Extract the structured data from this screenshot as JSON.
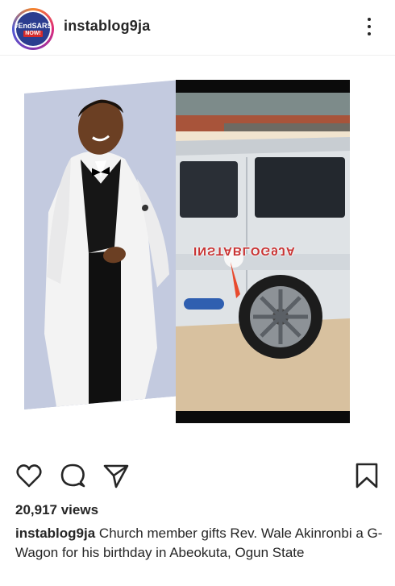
{
  "header": {
    "username": "instablog9ja",
    "avatar_text_line1": "#EndSARS",
    "avatar_text_line2": "NOW!"
  },
  "post": {
    "watermark": "INSTABLOG9JA",
    "views": "20,917 views",
    "caption_user": "instablog9ja",
    "caption_text": "Church member gifts Rev. Wale Akinronbi a G-Wagon for his birthday in Abeokuta, Ogun State"
  },
  "icons": [
    "more-options-icon",
    "heart-icon",
    "comment-icon",
    "share-icon",
    "bookmark-icon"
  ],
  "colors": {
    "text": "#262626",
    "avatar_bg": "#2b3d8f",
    "avatar_badge": "#d62b2b"
  }
}
